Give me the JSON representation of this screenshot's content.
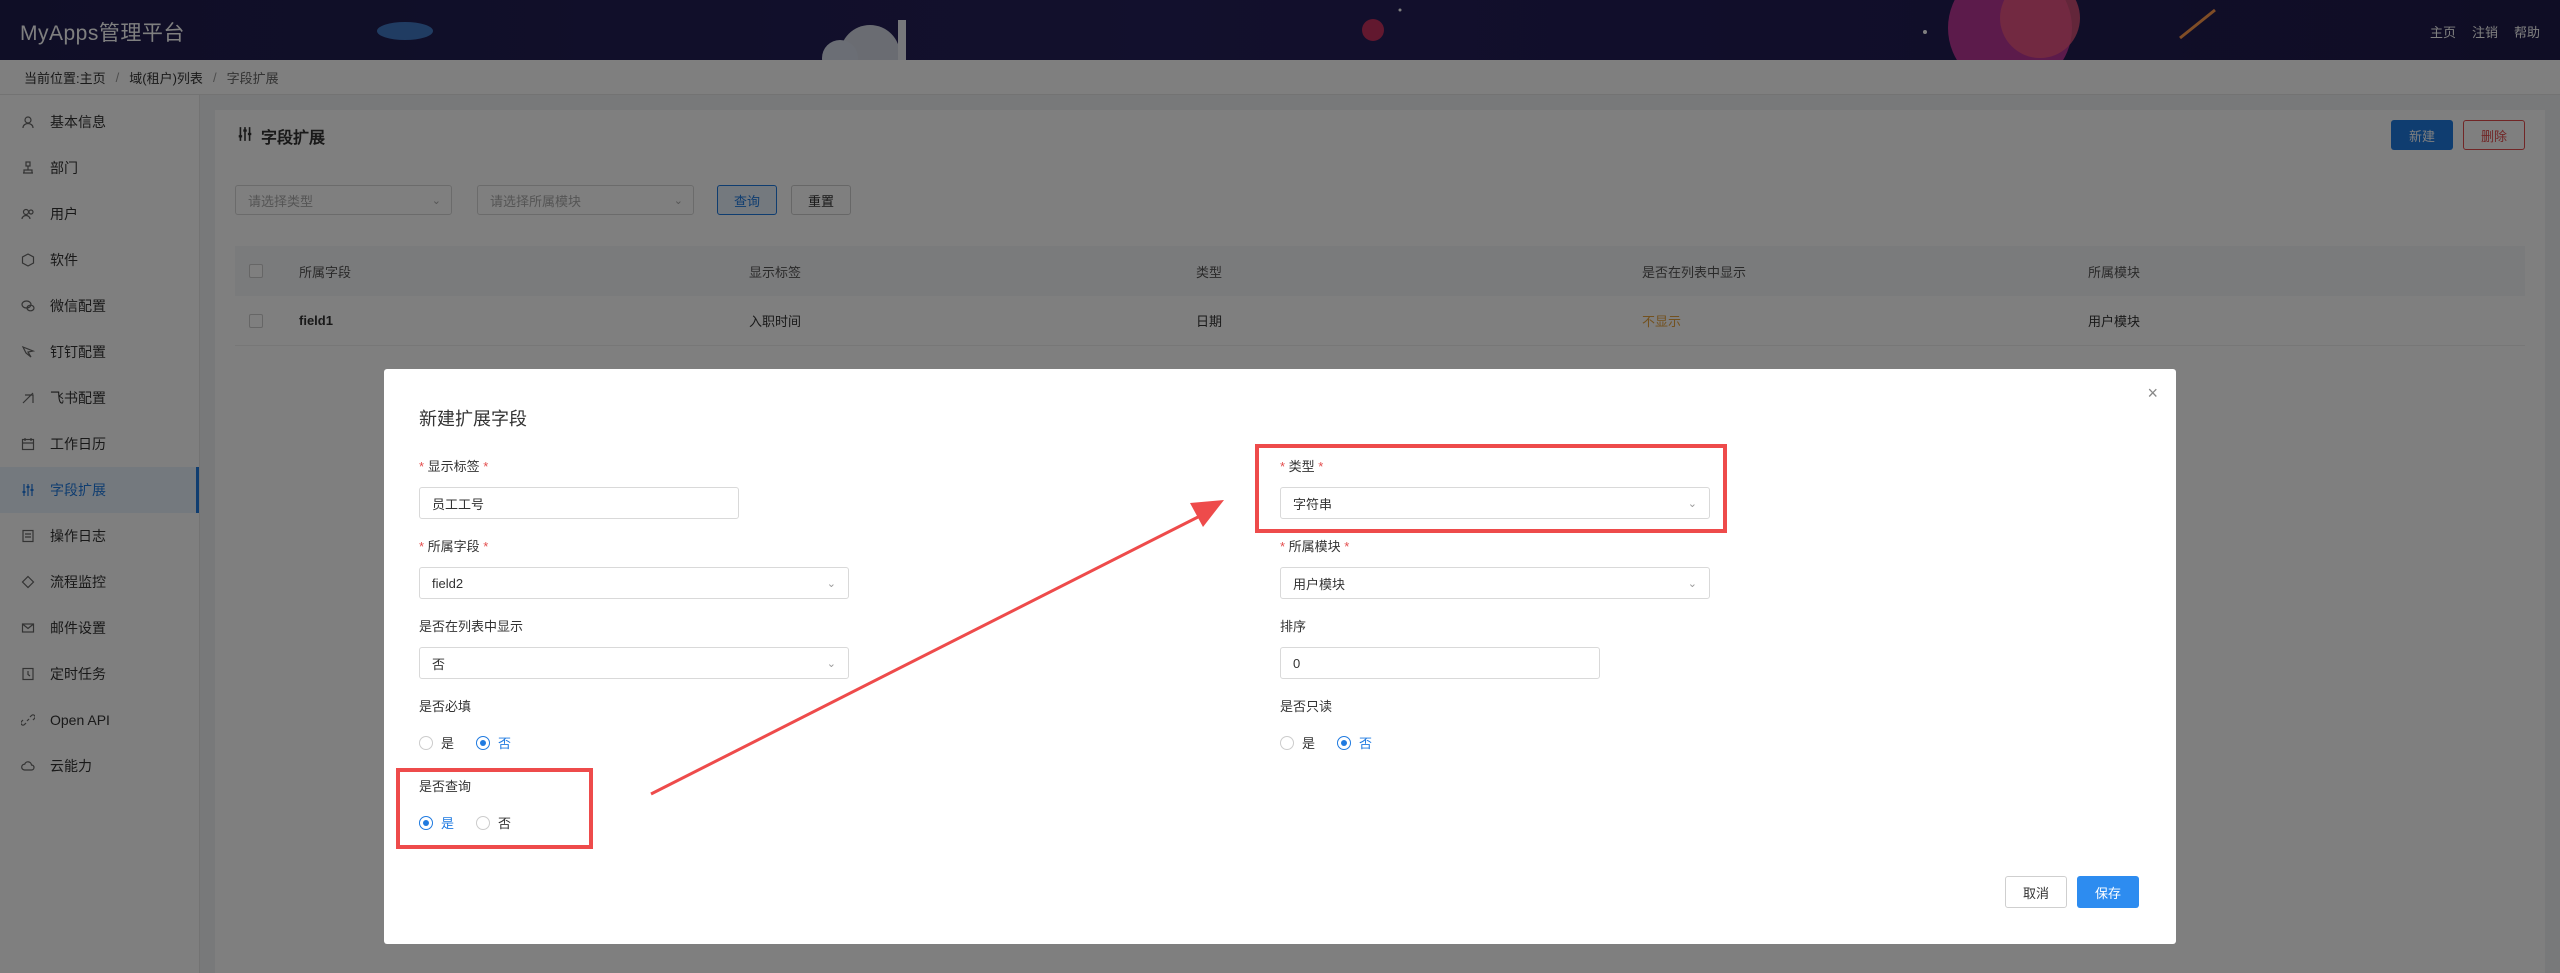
{
  "app": {
    "title": "MyApps管理平台"
  },
  "top_links": [
    "主页",
    "注销",
    "帮助"
  ],
  "breadcrumb": {
    "prefix": "当前位置:",
    "items": [
      "主页",
      "域(租户)列表"
    ],
    "current": "字段扩展"
  },
  "sidebar": {
    "items": [
      {
        "label": "基本信息",
        "icon": "user-icon"
      },
      {
        "label": "部门",
        "icon": "org-icon"
      },
      {
        "label": "用户",
        "icon": "users-icon"
      },
      {
        "label": "软件",
        "icon": "cube-icon"
      },
      {
        "label": "微信配置",
        "icon": "wechat-icon"
      },
      {
        "label": "钉钉配置",
        "icon": "dingtalk-icon"
      },
      {
        "label": "飞书配置",
        "icon": "feishu-icon"
      },
      {
        "label": "工作日历",
        "icon": "calendar-icon"
      },
      {
        "label": "字段扩展",
        "icon": "sliders-icon",
        "active": true
      },
      {
        "label": "操作日志",
        "icon": "log-icon"
      },
      {
        "label": "流程监控",
        "icon": "diamond-icon"
      },
      {
        "label": "邮件设置",
        "icon": "mail-icon"
      },
      {
        "label": "定时任务",
        "icon": "clock-icon"
      },
      {
        "label": "Open API",
        "icon": "link-icon"
      },
      {
        "label": "云能力",
        "icon": "cloud-icon"
      }
    ]
  },
  "panel": {
    "title": "字段扩展",
    "new_label": "新建",
    "delete_label": "删除",
    "filter_type_placeholder": "请选择类型",
    "filter_module_placeholder": "请选择所属模块",
    "query_label": "查询",
    "reset_label": "重置"
  },
  "table": {
    "headers": [
      "所属字段",
      "显示标签",
      "类型",
      "是否在列表中显示",
      "所属模块"
    ],
    "rows": [
      {
        "field": "field1",
        "label": "入职时间",
        "type": "日期",
        "show_in_list": "不显示",
        "module": "用户模块"
      }
    ]
  },
  "modal": {
    "title": "新建扩展字段",
    "close_symbol": "×",
    "display_label": {
      "label": "显示标签",
      "value": "员工工号"
    },
    "type": {
      "label": "类型",
      "value": "字符串"
    },
    "field": {
      "label": "所属字段",
      "value": "field2"
    },
    "module": {
      "label": "所属模块",
      "value": "用户模块"
    },
    "show_in_list": {
      "label": "是否在列表中显示",
      "value": "否"
    },
    "order": {
      "label": "排序",
      "value": "0"
    },
    "required": {
      "label": "是否必填",
      "options": [
        "是",
        "否"
      ],
      "selected": "否"
    },
    "readonly": {
      "label": "是否只读",
      "options": [
        "是",
        "否"
      ],
      "selected": "否"
    },
    "query": {
      "label": "是否查询",
      "options": [
        "是",
        "否"
      ],
      "selected": "是"
    },
    "cancel_label": "取消",
    "save_label": "保存"
  },
  "colors": {
    "accent": "#1f7ae0",
    "danger": "#e34d4d",
    "annotation": "#ee4b4b",
    "warning_text": "#e6a23c"
  }
}
